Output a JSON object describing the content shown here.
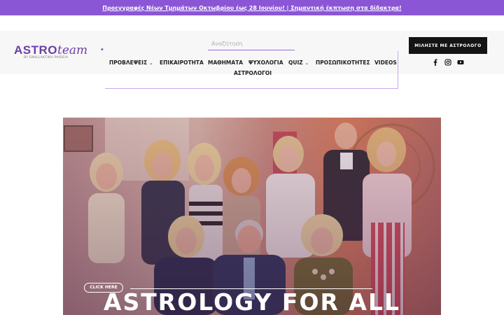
{
  "promo": {
    "text": "Προεγγραφές Νέων Τμημάτων Οκτωβρίου έως 28 Ιουνίου! | Σημαντική έκπτωση στα δίδακτρα!"
  },
  "logo": {
    "astro": "ASTRO",
    "team": "team",
    "sub": "BY ΕΝΑLLΑΚΤΙΚΗ PAIDEIA"
  },
  "search": {
    "placeholder": "Αναζήτηση",
    "value": ""
  },
  "nav": {
    "predictions": "ΠΡΟΒΛΕΨΕΙΣ",
    "news": "ΕΠΙΚΑΙΡΟΤΗΤΑ",
    "lessons": "ΜΑΘΗΜΑΤΑ",
    "psychology": "ΨΥΧΟΛΟΓΙΑ",
    "quiz": "QUIZ",
    "personalities": "ΠΡΟΣΩΠΙΚΟΤΗΤΕΣ",
    "videos": "VIDEOS",
    "astrologers": "ΑΣΤΡΟΛΟΓΟΙ"
  },
  "cta": {
    "label": "ΜΙΛΗΣΤΕ ΜΕ ΑΣΤΡΟΛΟΓΟ"
  },
  "social": [
    "facebook-icon",
    "instagram-icon",
    "youtube-icon"
  ],
  "hero": {
    "pill": "CLICK HERE",
    "title": "ASTROLOGY FOR ALL",
    "overlay_color": "#7b3f6b"
  },
  "colors": {
    "accent": "#8a56d6",
    "brand": "#6a3fa8",
    "button": "#141414"
  }
}
